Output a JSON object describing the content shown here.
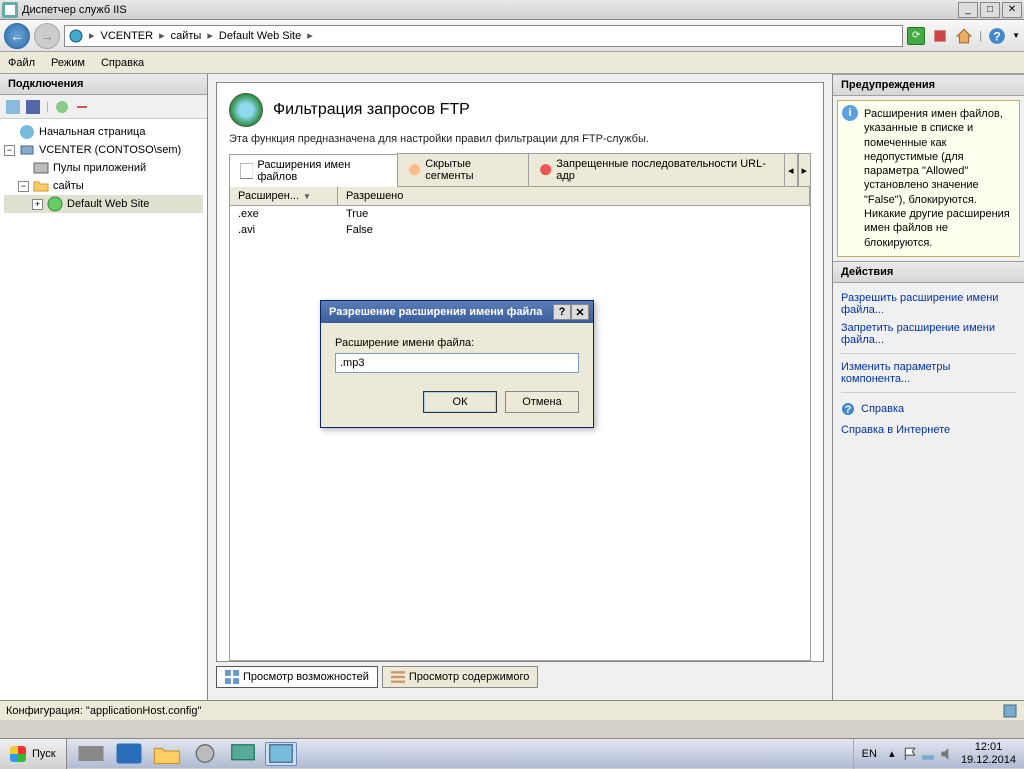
{
  "window": {
    "title": "Диспетчер служб IIS"
  },
  "win_buttons": {
    "min": "_",
    "max": "□",
    "close": "✕"
  },
  "nav": {
    "crumbs": [
      "VCENTER",
      "сайты",
      "Default Web Site"
    ],
    "sep": "▸"
  },
  "menu": {
    "file": "Файл",
    "mode": "Режим",
    "help": "Справка"
  },
  "connections": {
    "header": "Подключения",
    "items": {
      "start": "Начальная страница",
      "server": "VCENTER (CONTOSO\\sem)",
      "pools": "Пулы приложений",
      "sites": "сайты",
      "dws": "Default Web Site"
    }
  },
  "main": {
    "title": "Фильтрация запросов FTP",
    "desc": "Эта функция предназначена для настройки правил фильтрации для FTP-службы.",
    "tabs": {
      "ext": "Расширения имен файлов",
      "hidden": "Скрытые сегменты",
      "url": "Запрещенные последовательности URL-адр"
    },
    "columns": {
      "ext": "Расширен...",
      "allowed": "Разрешено"
    },
    "rows": [
      {
        "ext": ".exe",
        "allowed": "True"
      },
      {
        "ext": ".avi",
        "allowed": "False"
      }
    ],
    "bottom_tabs": {
      "features": "Просмотр возможностей",
      "content": "Просмотр содержимого"
    }
  },
  "warnings": {
    "header": "Предупреждения",
    "text": "Расширения имен файлов, указанные в списке и помеченные как недопустимые (для параметра \"Allowed\" установлено значение \"False\"), блокируются. Никакие другие расширения имен файлов не блокируются."
  },
  "actions": {
    "header": "Действия",
    "allow": "Разрешить расширение имени файла...",
    "deny": "Запретить расширение имени файла...",
    "edit": "Изменить параметры компонента...",
    "help": "Справка",
    "help_online": "Справка в Интернете"
  },
  "dialog": {
    "title": "Разрешение расширения имени файла",
    "label": "Расширение имени файла:",
    "value": ".mp3",
    "ok": "ОК",
    "cancel": "Отмена"
  },
  "status": {
    "text": "Конфигурация: \"applicationHost.config\""
  },
  "taskbar": {
    "start": "Пуск",
    "lang": "EN",
    "time": "12:01",
    "date": "19.12.2014"
  }
}
